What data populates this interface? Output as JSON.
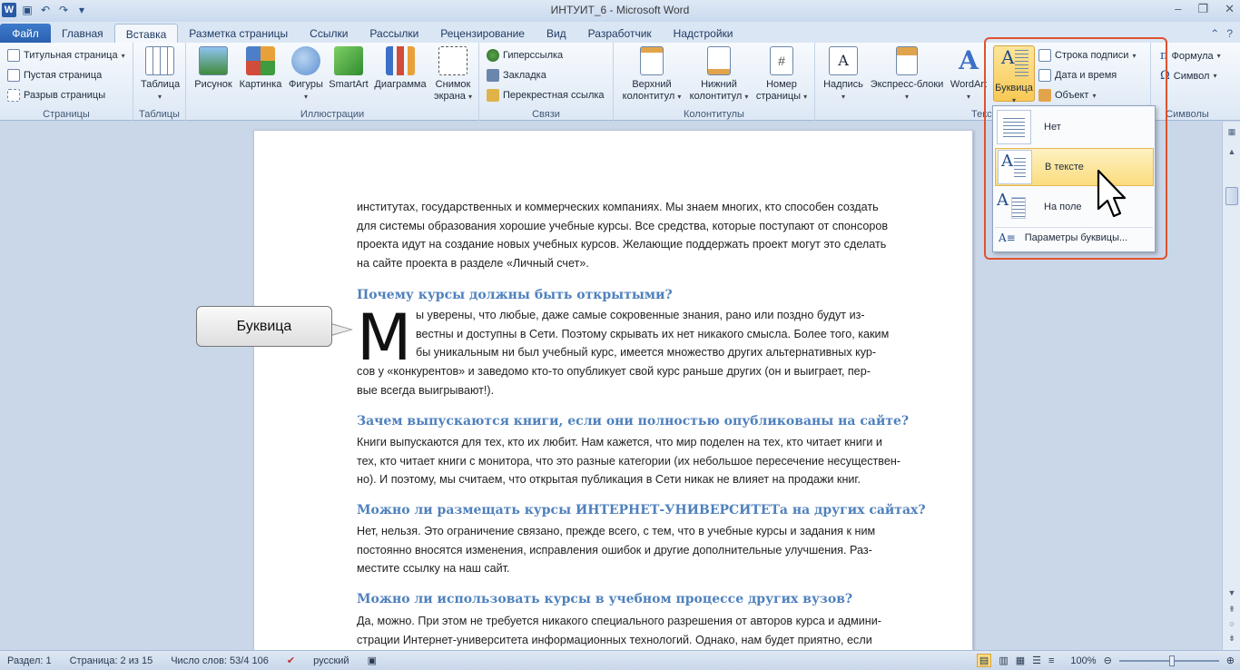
{
  "window": {
    "title": "ИНТУИТ_6 - Microsoft Word"
  },
  "tabs": [
    "Файл",
    "Главная",
    "Вставка",
    "Разметка страницы",
    "Ссылки",
    "Рассылки",
    "Рецензирование",
    "Вид",
    "Разработчик",
    "Надстройки"
  ],
  "ribbon": {
    "pages": {
      "label": "Страницы",
      "items": [
        "Титульная страница",
        "Пустая страница",
        "Разрыв страницы"
      ]
    },
    "tables": {
      "label": "Таблицы",
      "table": "Таблица"
    },
    "illustrations": {
      "label": "Иллюстрации",
      "items": [
        "Рисунок",
        "Картинка",
        "Фигуры",
        "SmartArt",
        "Диаграмма"
      ],
      "screenshot_l1": "Снимок",
      "screenshot_l2": "экрана"
    },
    "links": {
      "label": "Связи",
      "items": [
        "Гиперссылка",
        "Закладка",
        "Перекрестная ссылка"
      ]
    },
    "headers": {
      "label": "Колонтитулы",
      "header_l1": "Верхний",
      "header_l2": "колонтитул",
      "footer_l1": "Нижний",
      "footer_l2": "колонтитул",
      "pagenum_l1": "Номер",
      "pagenum_l2": "страницы"
    },
    "text": {
      "label": "Текс",
      "textbox": "Надпись",
      "express": "Экспресс-блоки",
      "wordart": "WordArt",
      "dropcap": "Буквица",
      "signature": "Строка подписи",
      "datetime": "Дата и время",
      "object": "Объект"
    },
    "symbols": {
      "label": "Символы",
      "formula": "Формула",
      "symbol": "Символ"
    }
  },
  "dropcap_menu": {
    "items": [
      "Нет",
      "В тексте",
      "На поле"
    ],
    "hovered": "В тексте",
    "options": "Параметры буквицы..."
  },
  "document": {
    "para1": [
      "институтах, государственных и коммерческих компаниях. Мы знаем многих, кто способен создать",
      "для системы образования хорошие учебные курсы. Все средства, которые поступают от спонсоров",
      "проекта идут на создание новых учебных курсов. Желающие поддержать проект могут это сделать",
      "на сайте проекта в разделе «Личный счет»."
    ],
    "h1": "Почему курсы должны быть открытыми?",
    "dropcap_letter": "М",
    "para2": [
      "ы уверены, что любые, даже самые сокровенные знания, рано или поздно будут из-",
      "вестны и доступны в Сети. Поэтому скрывать их нет никакого смысла. Более того, каким",
      "бы уникальным ни был учебный курс, имеется множество других альтернативных кур-",
      "сов у «конкурентов» и заведомо кто-то опубликует свой курс раньше других (он и выиграет, пер-",
      "вые всегда выигрывают!)."
    ],
    "h2": "Зачем выпускаются книги, если они полностью опубликованы на сайте?",
    "para3": [
      "Книги выпускаются для тех, кто их любит. Нам кажется, что мир поделен на тех, кто читает книги и",
      "тех, кто читает книги с монитора, что это разные категории (их небольшое пересечение несуществен-",
      "но). И поэтому, мы считаем, что открытая публикация в Сети никак не влияет на продажи книг."
    ],
    "h3": "Можно ли размещать курсы ИНТЕРНЕТ-УНИВЕРСИТЕТа  на других сайтах?",
    "para4": [
      "Нет, нельзя. Это ограничение связано, прежде всего, с тем, что в учебные курсы и задания к ним",
      "постоянно вносятся изменения, исправления ошибок и другие дополнительные улучшения. Раз-",
      "местите ссылку на наш сайт."
    ],
    "h4": "Можно ли использовать курсы в учебном процессе других вузов?",
    "para5": [
      "Да, можно. При этом не требуется никакого специального разрешения от авторов курса и админи-",
      "страции Интернет-университета информационных технологий. Однако, нам будет приятно, если"
    ]
  },
  "callout": "Буквица",
  "status": {
    "section": "Раздел: 1",
    "page": "Страница: 2 из 15",
    "words": "Число слов: 53/4 106",
    "language": "русский",
    "zoom": "100%"
  },
  "colors": {
    "accent": "#4f81bd",
    "highlight_border": "#e0522f",
    "hover": "#fbdc7e"
  }
}
